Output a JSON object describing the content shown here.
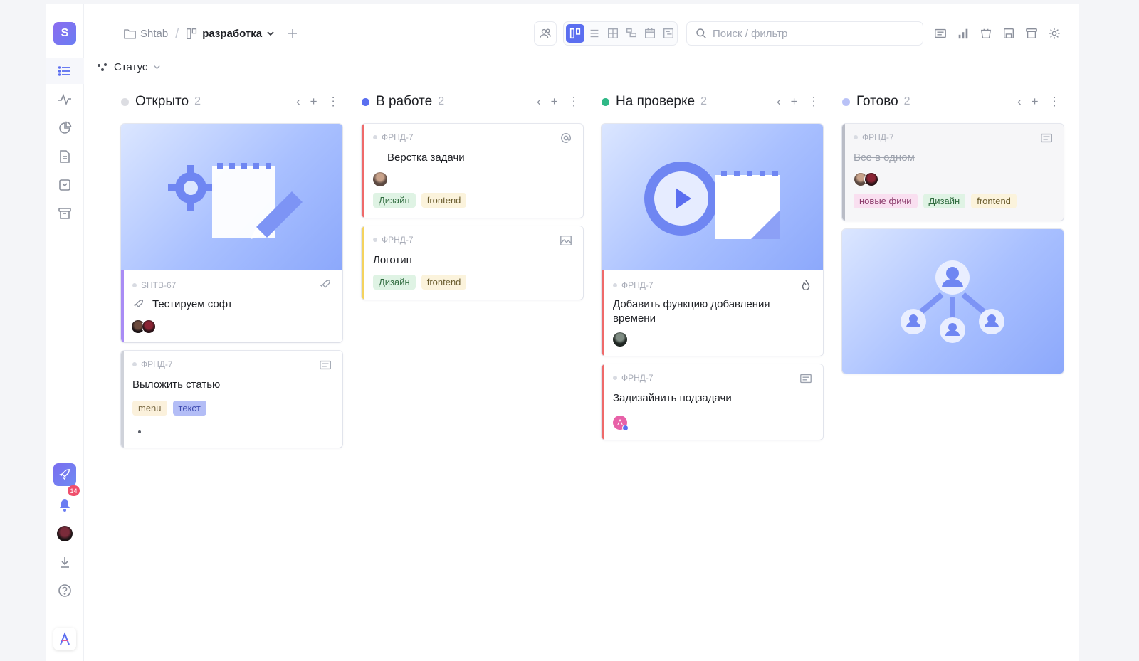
{
  "app": {
    "logo_letter": "S",
    "accent": "#6b7df2"
  },
  "breadcrumb": {
    "workspace": "Shtab",
    "separator": "/",
    "project": "разработка"
  },
  "search": {
    "placeholder": "Поиск / фильтр"
  },
  "filter": {
    "label": "Статус"
  },
  "sidebar": {
    "notifications_count": "14"
  },
  "columns": [
    {
      "title": "Открыто",
      "count": "2",
      "dot_color": "#dcdde2"
    },
    {
      "title": "В работе",
      "count": "2",
      "dot_color": "#5a6ff0"
    },
    {
      "title": "На проверке",
      "count": "2",
      "dot_color": "#2fb886"
    },
    {
      "title": "Готово",
      "count": "2",
      "dot_color": "#b9c2f7"
    }
  ],
  "cards": {
    "c1": {
      "id": "SHTB-67",
      "title": "Тестируем софт",
      "bar": "#a98cf5"
    },
    "c2": {
      "id": "ФРНД-7",
      "title": "Выложить статью",
      "tags": [
        "menu",
        "текст"
      ],
      "bar": "#cfd2da"
    },
    "c3": {
      "id": "ФРНД-7",
      "title": "Верстка задачи",
      "tags": [
        "Дизайн",
        "frontend"
      ],
      "bar": "#ef6a6a"
    },
    "c4": {
      "id": "ФРНД-7",
      "title": "Логотип",
      "tags": [
        "Дизайн",
        "frontend"
      ],
      "bar": "#f4d35e"
    },
    "c5": {
      "id": "ФРНД-7",
      "title": "Добавить функцию добавления времени",
      "bar": "#ef6a6a"
    },
    "c6": {
      "id": "ФРНД-7",
      "title": "Задизайнить подзадачи",
      "bar": "#ef6a6a"
    },
    "c7": {
      "id": "ФРНД-7",
      "title": "Все в одном",
      "tags": [
        "новые фичи",
        "Дизайн",
        "frontend"
      ],
      "bar": "#b9bcc6"
    }
  }
}
